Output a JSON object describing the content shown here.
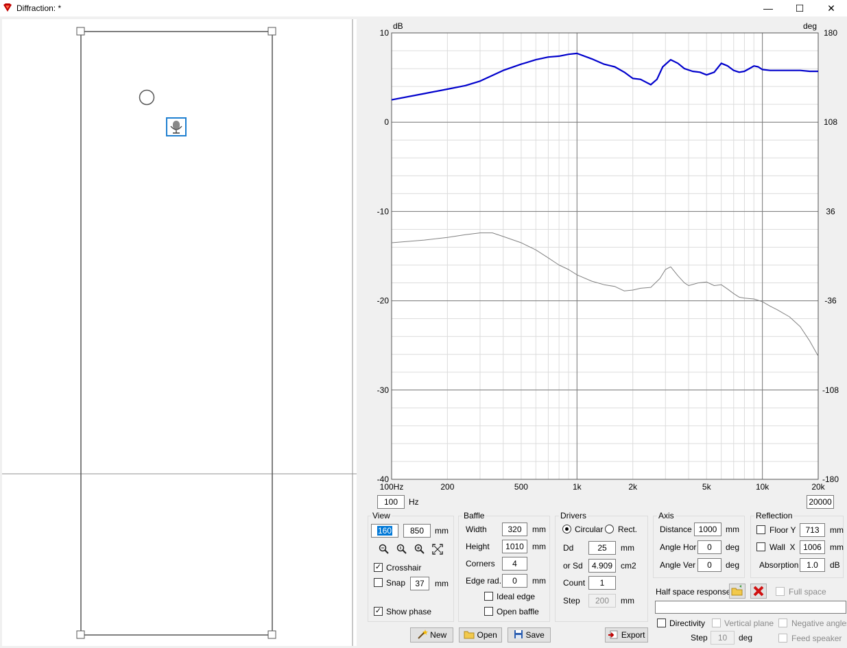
{
  "window": {
    "title": "Diffraction: *",
    "minimize_glyph": "—",
    "maximize_glyph": "☐",
    "close_glyph": "✕"
  },
  "chart_data": {
    "type": "line",
    "xscale": "log",
    "xlim": [
      100,
      20000
    ],
    "ylim": [
      -40,
      10
    ],
    "y2lim": [
      -180,
      180
    ],
    "grid": true,
    "ylabel": "dB",
    "y2label": "deg",
    "x_ticks": [
      {
        "value": 100,
        "label": "100Hz"
      },
      {
        "value": 200,
        "label": "200"
      },
      {
        "value": 500,
        "label": "500"
      },
      {
        "value": 1000,
        "label": "1k"
      },
      {
        "value": 2000,
        "label": "2k"
      },
      {
        "value": 5000,
        "label": "5k"
      },
      {
        "value": 10000,
        "label": "10k"
      },
      {
        "value": 20000,
        "label": "20k"
      }
    ],
    "y_ticks": [
      "10",
      "0",
      "-10",
      "-20",
      "-30",
      "-40"
    ],
    "y2_ticks": [
      "180",
      "108",
      "36",
      "-36",
      "-108",
      "-180"
    ],
    "series": [
      {
        "color": "#0000cc",
        "axis": "left",
        "x": [
          100,
          150,
          200,
          250,
          300,
          400,
          500,
          600,
          700,
          800,
          900,
          1000,
          1200,
          1400,
          1600,
          1800,
          2000,
          2200,
          2500,
          2700,
          2900,
          3200,
          3500,
          3800,
          4200,
          4600,
          5000,
          5500,
          6000,
          6500,
          7000,
          7500,
          8000,
          8500,
          9000,
          9500,
          10000,
          11000,
          12000,
          14000,
          16000,
          18000,
          20000
        ],
        "y": [
          2.5,
          3.2,
          3.7,
          4.1,
          4.6,
          5.8,
          6.5,
          7.0,
          7.3,
          7.4,
          7.6,
          7.7,
          7.1,
          6.5,
          6.2,
          5.6,
          4.9,
          4.8,
          4.2,
          4.8,
          6.2,
          7.0,
          6.6,
          6.0,
          5.7,
          5.6,
          5.3,
          5.6,
          6.6,
          6.3,
          5.8,
          5.6,
          5.7,
          6.0,
          6.3,
          6.2,
          5.9,
          5.8,
          5.8,
          5.8,
          5.8,
          5.7,
          5.7
        ]
      },
      {
        "color": "#808080",
        "axis": "right",
        "x": [
          100,
          150,
          200,
          250,
          300,
          350,
          400,
          500,
          600,
          700,
          800,
          900,
          1000,
          1200,
          1400,
          1600,
          1800,
          2000,
          2200,
          2500,
          2800,
          3000,
          3200,
          3500,
          3800,
          4000,
          4500,
          5000,
          5500,
          6000,
          6500,
          7000,
          7500,
          8000,
          9000,
          10000,
          11000,
          12000,
          14000,
          16000,
          18000,
          20000
        ],
        "y": [
          -13.5,
          -13.2,
          -12.9,
          -12.6,
          -12.4,
          -12.4,
          -12.8,
          -13.5,
          -14.3,
          -15.2,
          -16.0,
          -16.5,
          -17.1,
          -17.8,
          -18.2,
          -18.4,
          -18.9,
          -18.8,
          -18.6,
          -18.5,
          -17.5,
          -16.5,
          -16.2,
          -17.2,
          -18.0,
          -18.3,
          -18.0,
          -17.9,
          -18.3,
          -18.2,
          -18.7,
          -19.2,
          -19.6,
          -19.7,
          -19.8,
          -20.1,
          -20.6,
          -21.0,
          -21.8,
          -22.9,
          -24.5,
          -26.2
        ]
      }
    ]
  },
  "freq_range": {
    "min_value": "100",
    "unit": "Hz",
    "max_value": "20000"
  },
  "view": {
    "title": "View",
    "width_value": "160",
    "height_value": "850",
    "unit": "mm",
    "crosshair_label": "Crosshair",
    "crosshair_checked": "✓",
    "snap_label": "Snap",
    "snap_value": "37",
    "snap_unit": "mm",
    "show_phase_label": "Show phase",
    "show_phase_checked": "✓",
    "zoom_icons": [
      "zoom-out-icon",
      "zoom-reset-icon",
      "zoom-in-icon",
      "zoom-fit-icon"
    ]
  },
  "baffle": {
    "title": "Baffle",
    "width_label": "Width",
    "width_value": "320",
    "width_unit": "mm",
    "height_label": "Height",
    "height_value": "1010",
    "height_unit": "mm",
    "corners_label": "Corners",
    "corners_value": "4",
    "edge_label": "Edge rad.",
    "edge_value": "0",
    "edge_unit": "mm",
    "ideal_edge_label": "Ideal edge",
    "open_baffle_label": "Open baffle"
  },
  "drivers": {
    "title": "Drivers",
    "circular_label": "Circular",
    "rect_label": "Rect.",
    "dd_label": "Dd",
    "dd_value": "25",
    "dd_unit": "mm",
    "sd_label": "or Sd",
    "sd_value": "4.909",
    "sd_unit": "cm2",
    "count_label": "Count",
    "count_value": "1",
    "step_label": "Step",
    "step_value": "200",
    "step_unit": "mm"
  },
  "axis": {
    "title": "Axis",
    "distance_label": "Distance",
    "distance_value": "1000",
    "distance_unit": "mm",
    "angle_hor_label": "Angle Hor",
    "angle_hor_value": "0",
    "angle_hor_unit": "deg",
    "angle_ver_label": "Angle Ver",
    "angle_ver_value": "0",
    "angle_ver_unit": "deg"
  },
  "reflection": {
    "title": "Reflection",
    "floor_label": "Floor Y",
    "floor_value": "713",
    "floor_unit": "mm",
    "wall_label": "Wall  X",
    "wall_value": "1006",
    "wall_unit": "mm",
    "absorption_label": "Absorption",
    "absorption_value": "1.0",
    "absorption_unit": "dB"
  },
  "half_space": {
    "label": "Half space response",
    "full_space_label": "Full space",
    "path_value": ""
  },
  "directivity": {
    "label": "Directivity",
    "vertical_plane_label": "Vertical plane",
    "negative_angles_label": "Negative angles",
    "step_label": "Step",
    "step_value": "10",
    "step_unit": "deg",
    "feed_speaker_label": "Feed speaker"
  },
  "buttons": {
    "new": "New",
    "open": "Open",
    "save": "Save",
    "export": "Export"
  },
  "colors": {
    "accent": "#0078d7",
    "response_curve": "#0000cc",
    "phase_curve": "#808080"
  }
}
